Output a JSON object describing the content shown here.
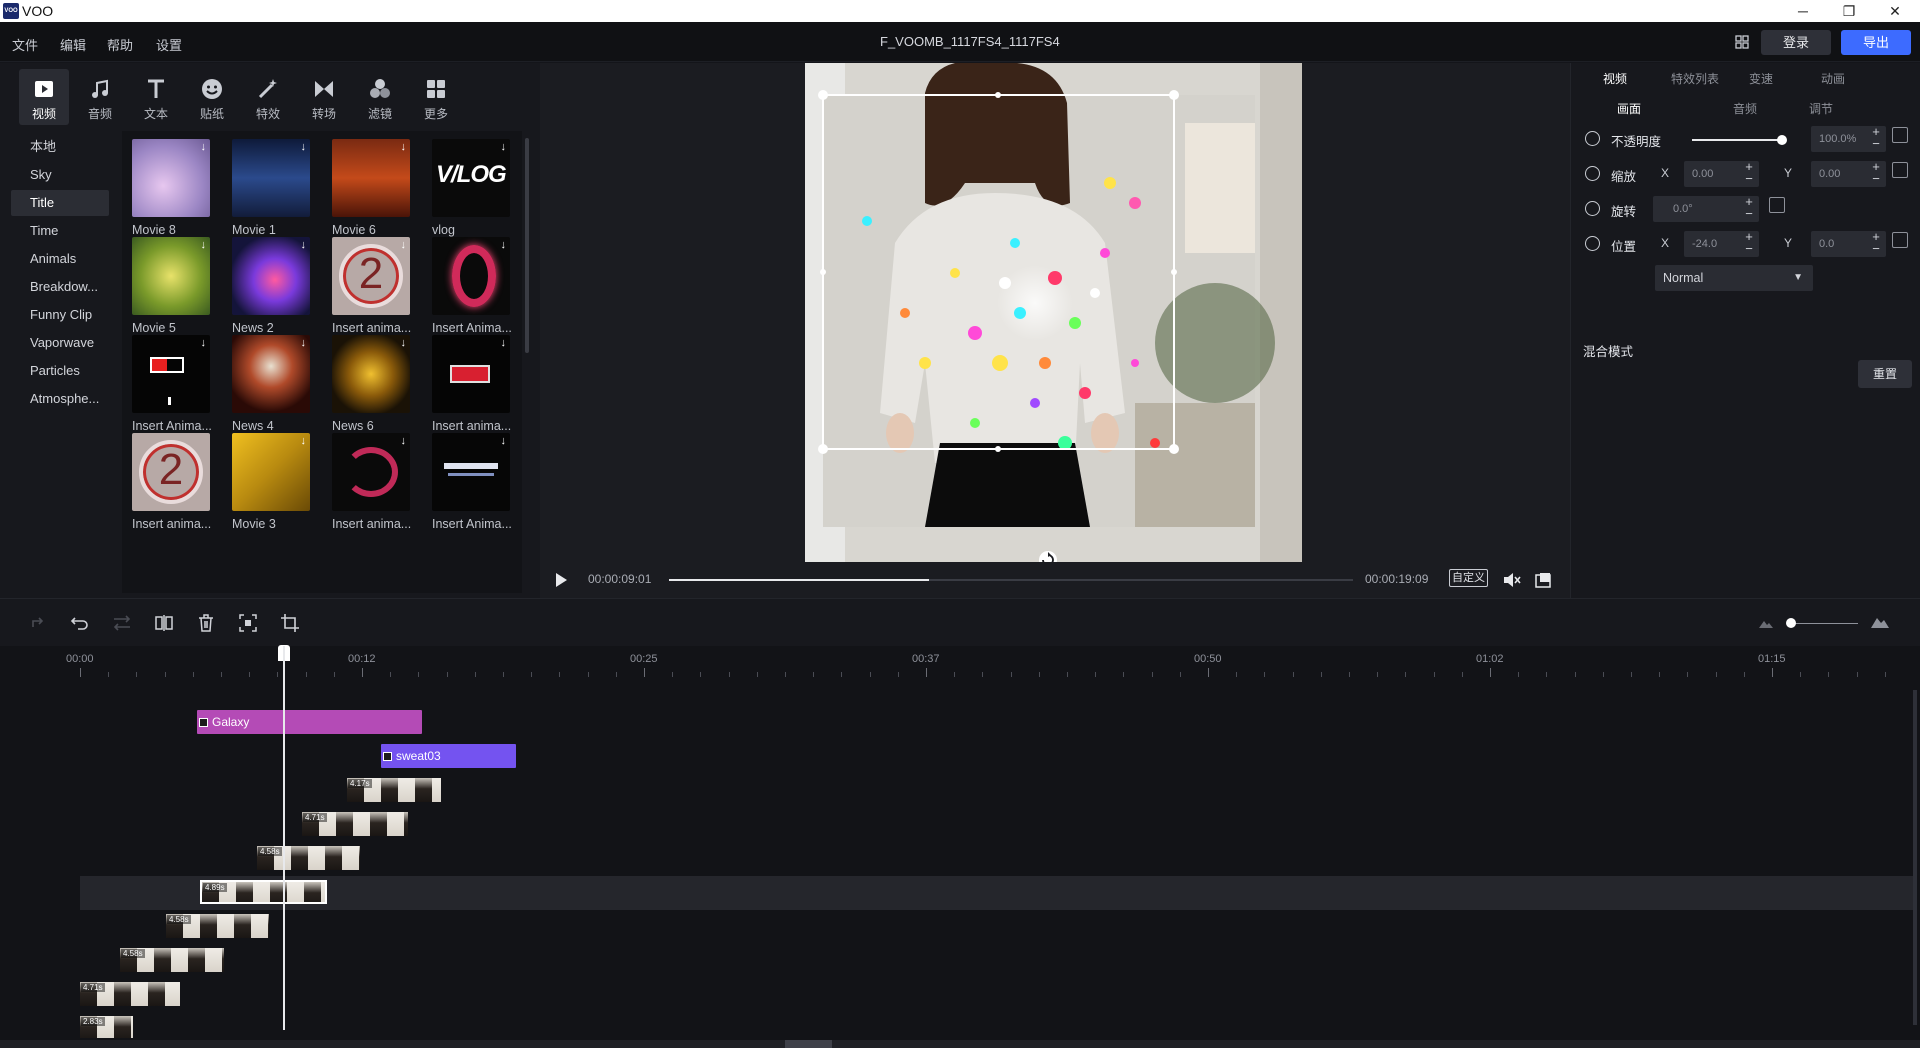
{
  "window": {
    "title": "VOO",
    "logo_text": "VOO"
  },
  "menu": {
    "file": "文件",
    "edit": "编辑",
    "help": "帮助",
    "settings": "设置"
  },
  "project": {
    "name": "F_VOOMB_1117FS4_1117FS4"
  },
  "header": {
    "login": "登录",
    "export": "导出"
  },
  "categories": [
    {
      "label": "视频",
      "icon": "video-icon"
    },
    {
      "label": "音频",
      "icon": "music-icon"
    },
    {
      "label": "文本",
      "icon": "text-icon"
    },
    {
      "label": "贴纸",
      "icon": "sticker-icon"
    },
    {
      "label": "特效",
      "icon": "effects-wand-icon"
    },
    {
      "label": "转场",
      "icon": "transition-icon"
    },
    {
      "label": "滤镜",
      "icon": "filter-icon"
    },
    {
      "label": "更多",
      "icon": "more-grid-icon"
    }
  ],
  "subnav": [
    "本地",
    "Sky",
    "Title",
    "Time",
    "Animals",
    "Breakdow...",
    "Funny Clip",
    "Vaporwave",
    "Particles",
    "Atmosphe..."
  ],
  "library": [
    "Movie 8",
    "Movie 1",
    "Movie 6",
    "vlog",
    "Movie 5",
    "News 2",
    "Insert anima...",
    "Insert Anima...",
    "Insert Anima...",
    "News 4",
    "News 6",
    "Insert anima...",
    "Insert anima...",
    "Movie 3",
    "Insert anima...",
    "Insert Anima..."
  ],
  "player": {
    "current": "00:00:09:01",
    "total": "00:00:19:09",
    "progress": 0.38,
    "custom": "自定义"
  },
  "props": {
    "tabs": [
      "视频",
      "特效列表",
      "变速",
      "动画"
    ],
    "subtabs": [
      "画面",
      "音频",
      "调节"
    ],
    "opacity_label": "不透明度",
    "opacity_value": "100.0%",
    "scale_label": "缩放",
    "scale_x": "0.00",
    "scale_y": "0.00",
    "rotate_label": "旋转",
    "rotate_value": "0.0°",
    "position_label": "位置",
    "pos_x": "-24.0",
    "pos_y": "0.0",
    "axis_x": "X",
    "axis_y": "Y",
    "blend_label": "混合模式",
    "blend_value": "Normal",
    "reset": "重置"
  },
  "ruler": [
    "00:00",
    "00:12",
    "00:25",
    "00:37",
    "00:50",
    "01:02",
    "01:15"
  ],
  "tracks": {
    "galaxy": "Galaxy",
    "sweat": "sweat03",
    "durations": [
      "4.17s",
      "4.71s",
      "4.58s",
      "4.89s",
      "4.58s",
      "4.58s",
      "4.71s",
      "2.83s"
    ]
  },
  "colors": {
    "accent": "#3d6bff",
    "galaxy_clip": "#b44bb6",
    "sweat_clip": "#7453f0"
  }
}
